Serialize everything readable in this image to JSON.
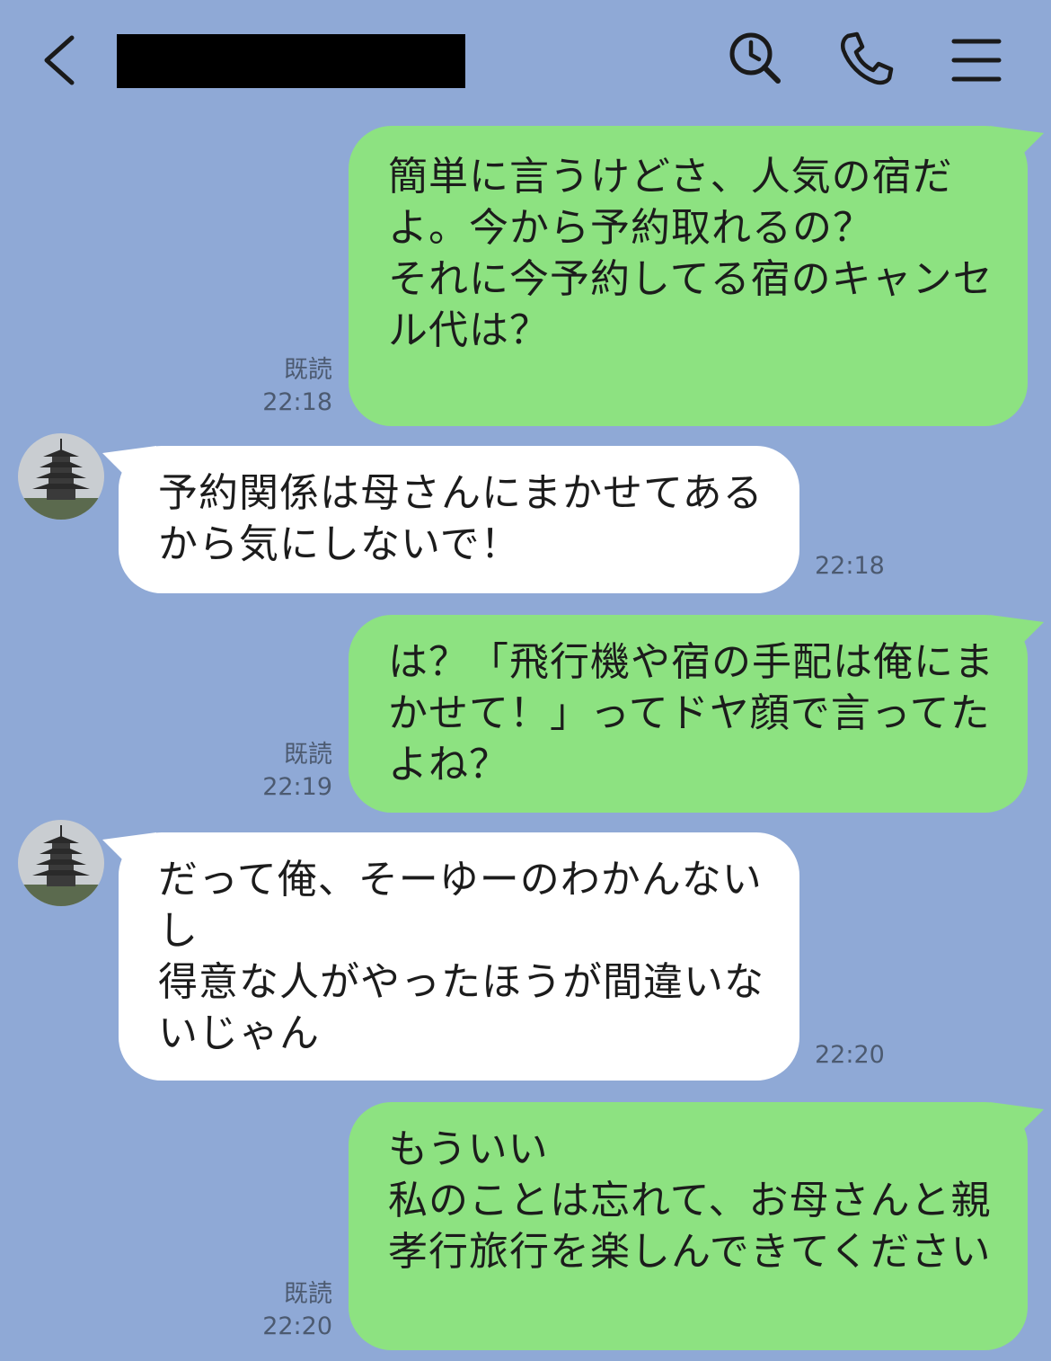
{
  "header": {
    "title": "",
    "back_icon": "chevron-left-icon",
    "search_icon": "search-icon",
    "call_icon": "phone-icon",
    "menu_icon": "menu-icon"
  },
  "colors": {
    "background": "#8fa9d6",
    "sent_bubble": "#8de281",
    "received_bubble": "#ffffff"
  },
  "messages": [
    {
      "direction": "sent",
      "text": "簡単に言うけどさ、人気の宿だ\nよ。今から予約取れるの？\nそれに今予約してる宿のキャンセ\nル代は？",
      "read": "既読",
      "time": "22:18"
    },
    {
      "direction": "received",
      "text": "予約関係は母さんにまかせてある\nから気にしないで！",
      "time": "22:18"
    },
    {
      "direction": "sent",
      "text": "は？「飛行機や宿の手配は俺にま\nかせて！」ってドヤ顔で言ってた\nよね？",
      "read": "既読",
      "time": "22:19"
    },
    {
      "direction": "received",
      "text": "だって俺、そーゆーのわかんない\nし\n得意な人がやったほうが間違いな\nいじゃん",
      "time": "22:20"
    },
    {
      "direction": "sent",
      "text": "もういい\n私のことは忘れて、お母さんと親\n孝行旅行を楽しんできてください",
      "read": "既読",
      "time": "22:20"
    }
  ]
}
